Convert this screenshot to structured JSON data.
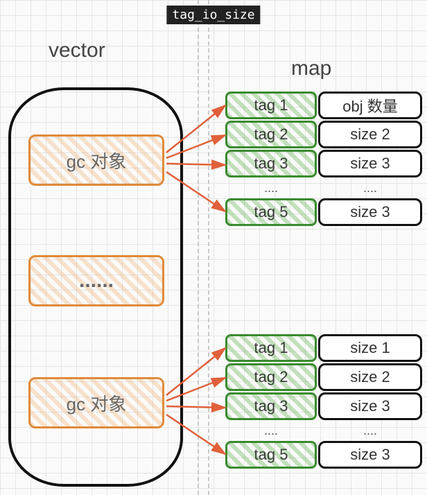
{
  "title": "tag_io_size",
  "labels": {
    "vector": "vector",
    "map": "map"
  },
  "vector": {
    "items": [
      {
        "label": "gc  对象"
      },
      {
        "label": "......"
      },
      {
        "label": "gc  对象"
      }
    ]
  },
  "maps": [
    {
      "rows": [
        {
          "tag": "tag 1",
          "value": "obj 数量"
        },
        {
          "tag": "tag 2",
          "value": "size 2"
        },
        {
          "tag": "tag 3",
          "value": "size 3"
        }
      ],
      "ellipsis": {
        "tag": "....",
        "value": "...."
      },
      "tail": {
        "tag": "tag 5",
        "value": "size 3"
      }
    },
    {
      "rows": [
        {
          "tag": "tag 1",
          "value": "size 1"
        },
        {
          "tag": "tag 2",
          "value": "size 2"
        },
        {
          "tag": "tag 3",
          "value": "size 3"
        }
      ],
      "ellipsis": {
        "tag": "....",
        "value": "...."
      },
      "tail": {
        "tag": "tag 5",
        "value": "size 3"
      }
    }
  ]
}
